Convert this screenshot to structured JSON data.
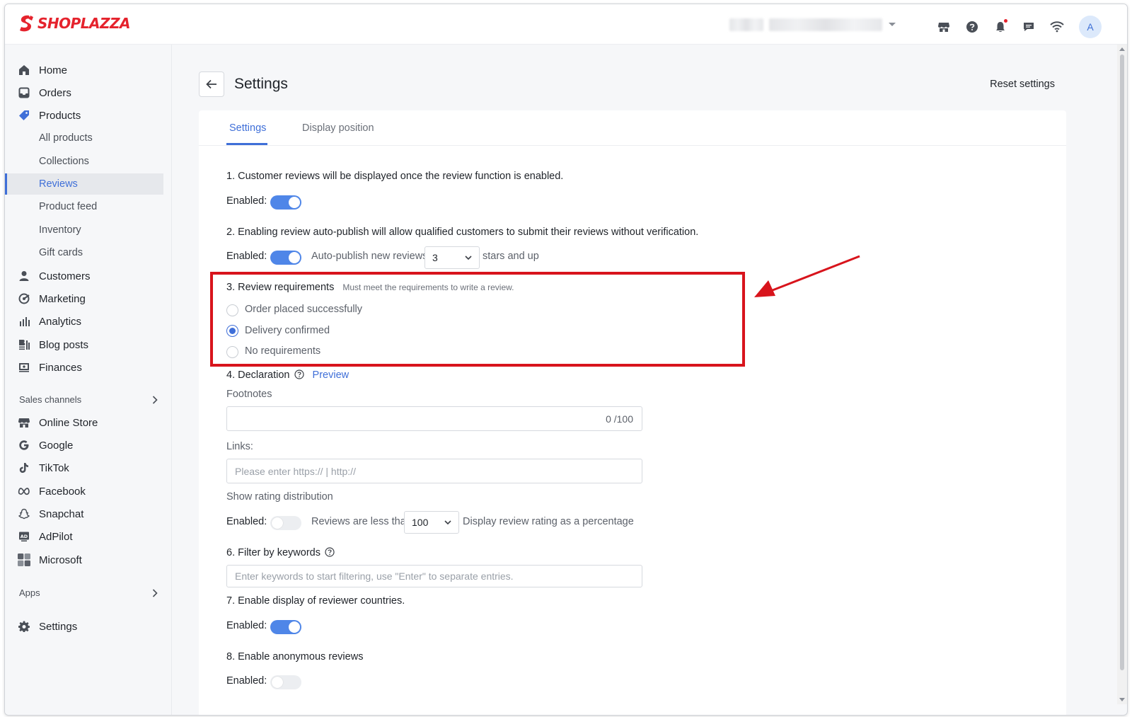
{
  "brand": {
    "name": "SHOPLAZZA",
    "accent": "#e5232d",
    "primary": "#3f6fd8"
  },
  "topbar": {
    "avatar_letter": "A",
    "icons": [
      "store-icon",
      "help-icon",
      "bell-icon",
      "chat-icon",
      "wifi-icon"
    ]
  },
  "sidebar": {
    "items": [
      {
        "label": "Home",
        "icon": "home-icon"
      },
      {
        "label": "Orders",
        "icon": "orders-icon"
      },
      {
        "label": "Products",
        "icon": "tag-icon"
      },
      {
        "label": "Customers",
        "icon": "person-icon"
      },
      {
        "label": "Marketing",
        "icon": "marketing-icon"
      },
      {
        "label": "Analytics",
        "icon": "analytics-icon"
      },
      {
        "label": "Blog posts",
        "icon": "blog-icon"
      },
      {
        "label": "Finances",
        "icon": "finances-icon"
      }
    ],
    "product_sub": [
      "All products",
      "Collections",
      "Reviews",
      "Product feed",
      "Inventory",
      "Gift cards"
    ],
    "active_sub": "Reviews",
    "sales_channels_label": "Sales channels",
    "channels": [
      {
        "label": "Online Store",
        "icon": "store-icon"
      },
      {
        "label": "Google",
        "icon": "google-icon"
      },
      {
        "label": "TikTok",
        "icon": "tiktok-icon"
      },
      {
        "label": "Facebook",
        "icon": "meta-icon"
      },
      {
        "label": "Snapchat",
        "icon": "snapchat-icon"
      },
      {
        "label": "AdPilot",
        "icon": "adpilot-icon"
      },
      {
        "label": "Microsoft",
        "icon": "microsoft-icon"
      }
    ],
    "apps_label": "Apps",
    "settings_label": "Settings"
  },
  "page": {
    "title": "Settings",
    "reset_label": "Reset settings",
    "tabs": [
      "Settings",
      "Display position"
    ]
  },
  "form": {
    "s1_text": "1. Customer reviews will be displayed once the review function is enabled.",
    "enabled_label": "Enabled",
    "colon": ":",
    "s2_text": "2. Enabling review auto-publish will allow qualified customers to submit their reviews without verification.",
    "autopublish_label": "Auto-publish new reviews",
    "stars_value": "3",
    "stars_suffix": "stars and up",
    "s3_title": "3. Review requirements",
    "s3_note": "Must meet the requirements to write a review.",
    "s3_options": [
      "Order placed successfully",
      "Delivery confirmed",
      "No requirements"
    ],
    "s3_selected": "Delivery confirmed",
    "s4_title": "4. Declaration",
    "preview_label": "Preview",
    "footnotes_label": "Footnotes",
    "footnotes_counter": "0 /100",
    "links_label": "Links:",
    "links_placeholder": "Please enter https:// | http://",
    "rating_dist_label": "Show rating distribution",
    "reviews_less_label": "Reviews are less than",
    "reviews_less_value": "100",
    "percentage_label": "Display review rating as a percentage",
    "s6_title": "6. Filter by keywords",
    "keywords_placeholder": "Enter keywords to start filtering, use \"Enter\" to separate entries.",
    "s7_title": "7. Enable display of reviewer countries.",
    "s8_title": "8. Enable anonymous reviews"
  }
}
